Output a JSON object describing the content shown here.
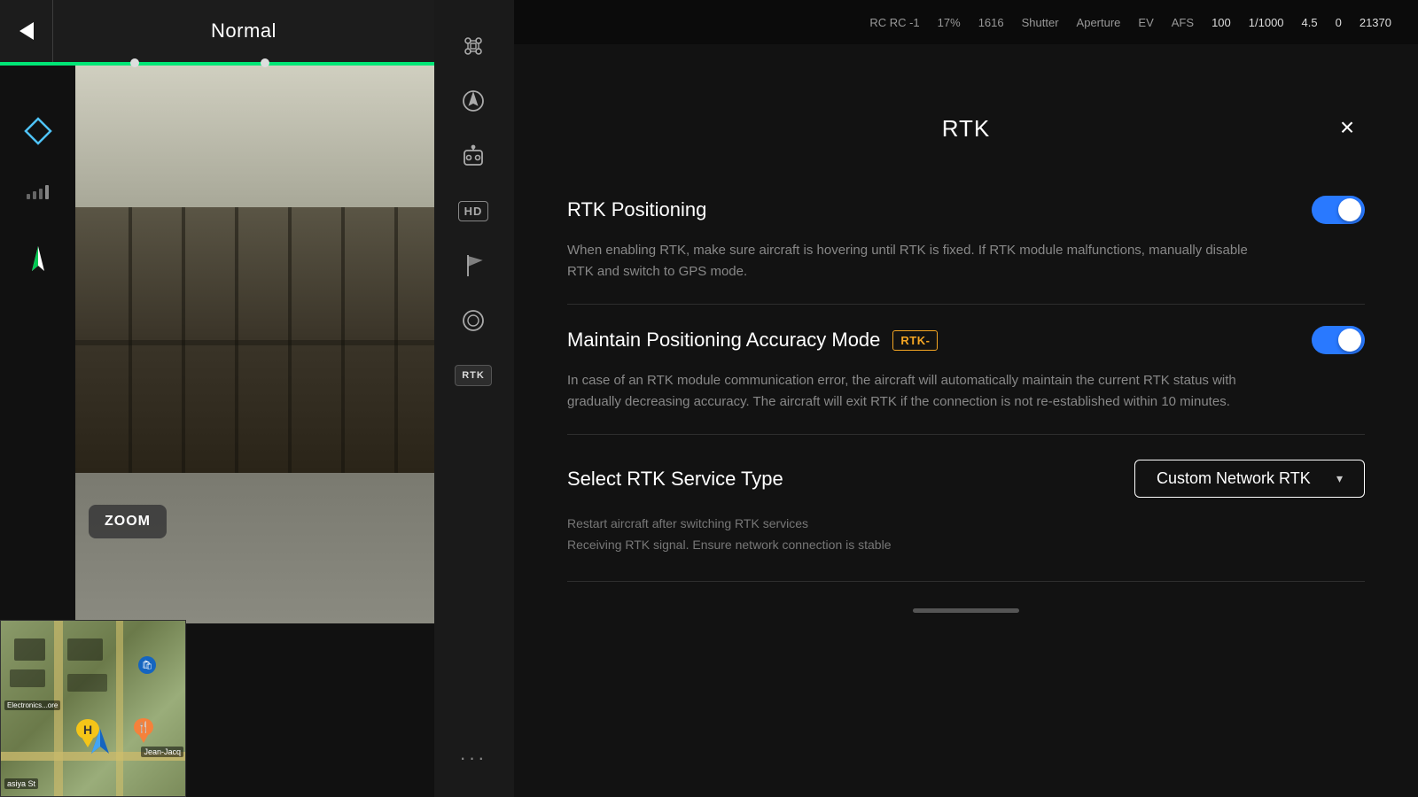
{
  "topBar": {
    "backLabel": "Back",
    "modeLabel": "Normal"
  },
  "leftSidebar": {
    "zoomLabel": "ZOOM"
  },
  "rightSidebarIcons": {
    "droneIconTitle": "Drone",
    "navIconTitle": "Navigation",
    "cameraIconTitle": "Camera settings",
    "hdLabel": "HD",
    "waypointIconTitle": "Waypoint",
    "cameraShutterTitle": "Camera shutter",
    "rtkLabel": "RTK",
    "moreOptionsTitle": "More options"
  },
  "statusBar": {
    "rcSignal": "RC -1",
    "batteryLeft": "17%",
    "resolution": "1616",
    "shutter": "Shutter",
    "aperture": "Aperture",
    "ev": "EV",
    "storage": "AFS",
    "isoLabel": "100",
    "shutterValue": "1/1000",
    "apertureValue": "4.5",
    "evValue": "0",
    "storageValue": "21370"
  },
  "rtkPanel": {
    "title": "RTK",
    "closeLabel": "×",
    "rtkPositioning": {
      "label": "RTK Positioning",
      "toggleOn": true,
      "description": "When enabling RTK, make sure aircraft is hovering until RTK is fixed. If RTK module malfunctions, manually disable RTK and switch to GPS mode."
    },
    "maintainPositioning": {
      "label": "Maintain Positioning Accuracy Mode",
      "badge": "RTK-",
      "toggleOn": true,
      "description": "In case of an RTK module communication error, the aircraft will automatically maintain the current RTK status with gradually decreasing accuracy. The aircraft will exit RTK if the connection is not re-established within 10 minutes."
    },
    "serviceType": {
      "label": "Select RTK Service Type",
      "currentValue": "Custom Network RTK",
      "dropdownArrow": "▾",
      "note1": "Restart aircraft after switching RTK services",
      "note2": "Receiving RTK signal. Ensure network connection is stable"
    }
  },
  "mapThumbnail": {
    "streetLabel": "Jean-Jacq",
    "streetLabel2": "asiya St",
    "storeLabel": "Electronics...ore"
  }
}
